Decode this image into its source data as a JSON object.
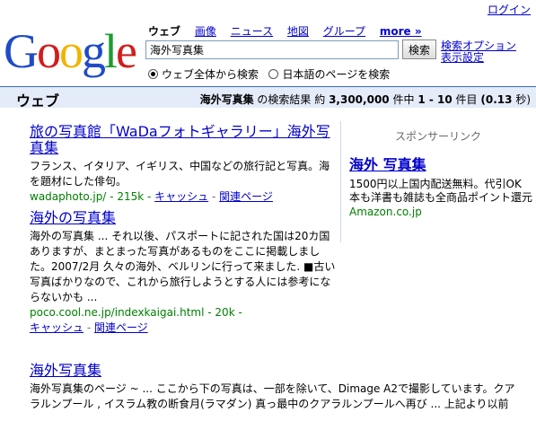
{
  "header": {
    "login": "ログイン",
    "logo_text": "Google",
    "nav": {
      "web": "ウェブ",
      "images": "画像",
      "news": "ニュース",
      "maps": "地図",
      "groups": "グループ",
      "more": "more »"
    },
    "search_value": "海外写真集",
    "search_button": "検索",
    "advanced_search": "検索オプション",
    "preferences": "表示設定",
    "radio_all": "ウェブ全体から検索",
    "radio_japanese": "日本語のページを検索"
  },
  "bar": {
    "title": "ウェブ",
    "query": "海外写真集",
    "stats_prefix": "の検索結果 約",
    "total": "3,300,000",
    "stats_mid": "件中",
    "range": "1 - 10",
    "stats_suffix": "件目",
    "time": "(0.13",
    "time_unit": "秒)"
  },
  "results": [
    {
      "title": "旅の写真館「WaDaフォトギャラリー」海外写真集",
      "snippet": "フランス、イタリア、イギリス、中国などの旅行記と写真。海を題材にした俳句。",
      "url": "wadaphoto.jp/",
      "size": "215k",
      "cache": "キャッシュ",
      "related": "関連ページ"
    },
    {
      "title": "海外の写真集",
      "snippet": "海外の写真集 ... それ以後、パスポートに記された国は20カ国ありますが、まとまった写真があるものをここに掲載しました。2007/2月 久々の海外、ベルリンに行って来ました. ■古い写真ばかりなので、これから旅行しようとする人には参考にならないかも ...",
      "url": "poco.cool.ne.jp/indexkaigai.html",
      "size": "20k",
      "cache": "キャッシュ",
      "related": "関連ページ"
    },
    {
      "title": "海外写真集",
      "snippet": "海外写真集のページ ~ ... ここから下の写真は、一部を除いて、Dimage A2で撮影しています。クアラルンプール , イスラム教の断食月(ラマダン) 真っ最中のクアラルンプールへ再び ... 上記より以前"
    }
  ],
  "sponsor": {
    "label": "スポンサーリンク",
    "ad_title": "海外 写真集",
    "ad_line1": "1500円以上国内配送無料。代引OK",
    "ad_line2": "本も洋書も雑誌も全商品ポイント還元!",
    "ad_url": "Amazon.co.jp"
  },
  "colors": {
    "logo": [
      "#1f4bc9",
      "#d21d1d",
      "#f0b400",
      "#1f4bc9",
      "#1d9c32",
      "#d21d1d"
    ],
    "link": "#0000cc",
    "url_green": "#008000",
    "bar_bg": "#e5ecf9"
  }
}
